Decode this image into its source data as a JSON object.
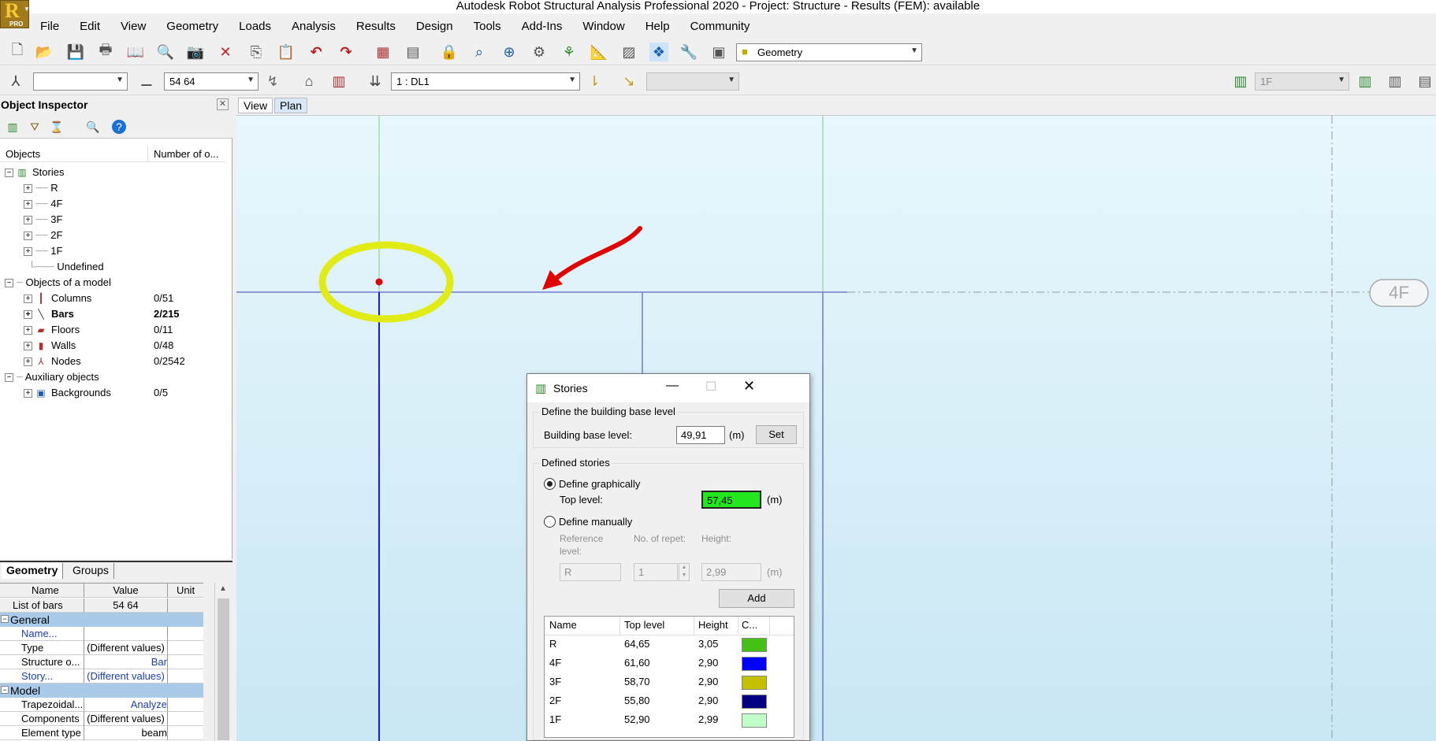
{
  "app": {
    "title": "Autodesk Robot Structural Analysis Professional 2020 - Project: Structure - Results (FEM): available",
    "logo_letter": "R",
    "logo_badge": "PRO"
  },
  "menu": [
    "File",
    "Edit",
    "View",
    "Geometry",
    "Loads",
    "Analysis",
    "Results",
    "Design",
    "Tools",
    "Add-Ins",
    "Window",
    "Help",
    "Community"
  ],
  "toolbar": {
    "layout_combo": "Geometry",
    "bar_list_value": "54 64",
    "load_case_value": "1 : DL1",
    "selection_combo": "",
    "story_combo": "1F"
  },
  "inspector": {
    "title": "Object Inspector",
    "col_objects": "Objects",
    "col_count": "Number of o...",
    "tree": {
      "stories_label": "Stories",
      "stories": [
        "R",
        "4F",
        "3F",
        "2F",
        "1F"
      ],
      "undefined": "Undefined",
      "objects_of_model": "Objects of a model",
      "items": [
        {
          "label": "Columns",
          "count": "0/51"
        },
        {
          "label": "Bars",
          "count": "2/215"
        },
        {
          "label": "Floors",
          "count": "0/11"
        },
        {
          "label": "Walls",
          "count": "0/48"
        },
        {
          "label": "Nodes",
          "count": "0/2542"
        }
      ],
      "auxiliary": "Auxiliary objects",
      "backgrounds": {
        "label": "Backgrounds",
        "count": "0/5"
      }
    },
    "tabs": [
      "Geometry",
      "Groups"
    ],
    "props_header": {
      "name": "Name",
      "value": "Value",
      "unit": "Unit"
    },
    "list_of_bars": {
      "name": "List of bars",
      "value": "54 64"
    },
    "sections": {
      "general": "General",
      "model": "Model"
    },
    "general_rows": [
      {
        "name": "Name...",
        "value": ""
      },
      {
        "name": "Type",
        "value": "(Different values)"
      },
      {
        "name": "Structure o...",
        "value": "Bar"
      },
      {
        "name": "Story...",
        "value": "(Different values)"
      }
    ],
    "model_rows": [
      {
        "name": "Trapezoidal...",
        "value": "Analyze"
      },
      {
        "name": "Components",
        "value": "(Different values)"
      },
      {
        "name": "Element type",
        "value": "beam"
      }
    ]
  },
  "view_tabs": [
    "View",
    "Plan"
  ],
  "canvas": {
    "story_label": "4F"
  },
  "dialog": {
    "title": "Stories",
    "base_group": "Define the building base level",
    "base_label": "Building base level:",
    "base_value": "49,91",
    "unit": "(m)",
    "set_button": "Set",
    "defined_group": "Defined stories",
    "graphically": "Define graphically",
    "top_level_label": "Top level:",
    "top_level_value": "57,45",
    "manually": "Define manually",
    "ref_label_1": "Reference",
    "ref_label_2": "level:",
    "repet_label": "No. of repet:",
    "height_label": "Height:",
    "ref_value": "R",
    "repet_value": "1",
    "height_value": "2,99",
    "add_button": "Add",
    "table_headers": {
      "name": "Name",
      "top": "Top level",
      "height": "Height",
      "color": "C..."
    },
    "stories": [
      {
        "name": "R",
        "top": "64,65",
        "height": "3,05",
        "color": "#44c016"
      },
      {
        "name": "4F",
        "top": "61,60",
        "height": "2,90",
        "color": "#0000ff"
      },
      {
        "name": "3F",
        "top": "58,70",
        "height": "2,90",
        "color": "#c4c000"
      },
      {
        "name": "2F",
        "top": "55,80",
        "height": "2,90",
        "color": "#000080"
      },
      {
        "name": "1F",
        "top": "52,90",
        "height": "2,99",
        "color": "#c0ffc8"
      }
    ]
  }
}
